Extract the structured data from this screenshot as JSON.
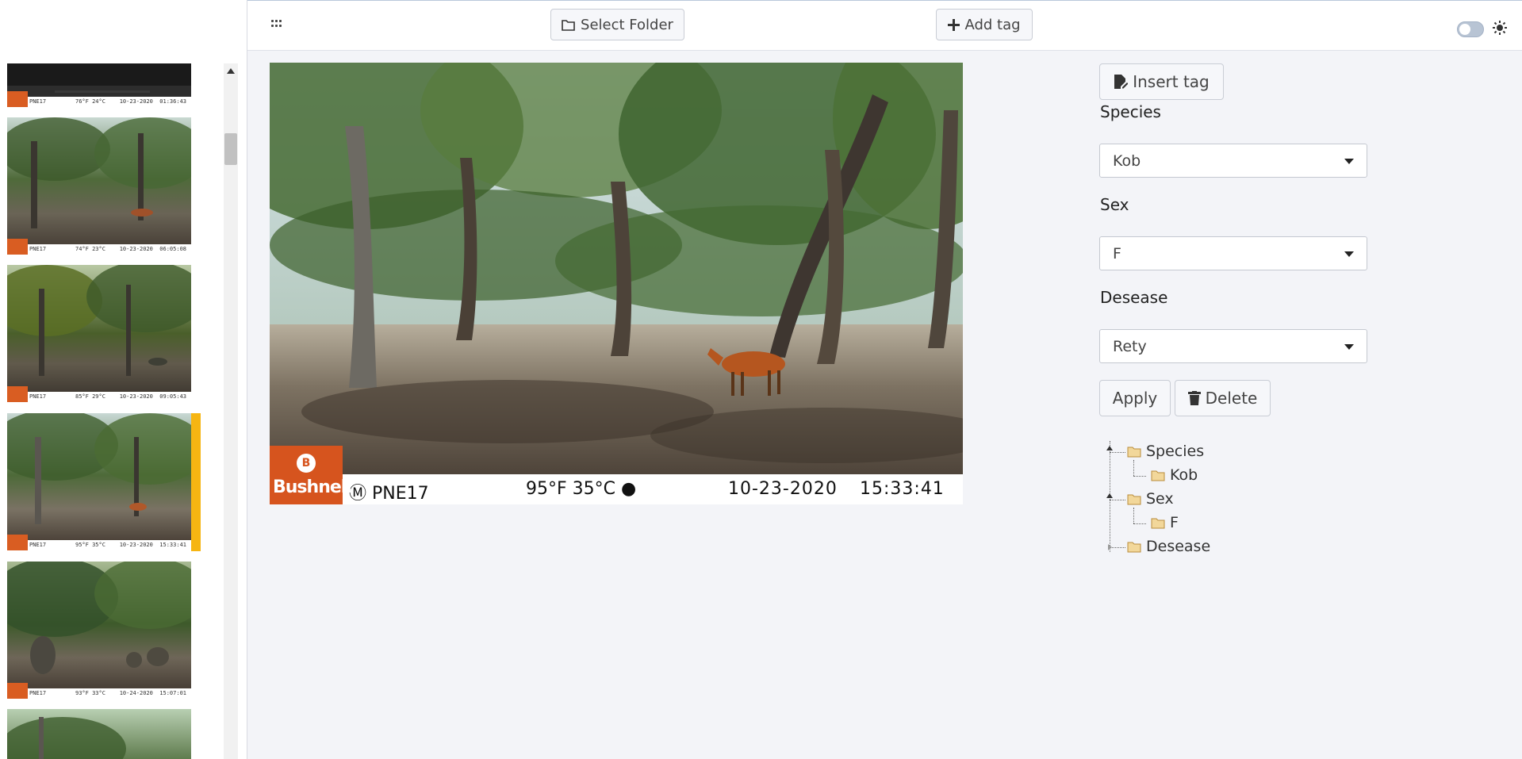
{
  "header": {
    "select_folder_label": "Select Folder",
    "add_tag_label": "Add tag",
    "menu_icon": "grid-icon",
    "theme_icon": "sun-icon",
    "theme_toggle_on": false
  },
  "sidebar": {
    "thumbnails": [
      {
        "camera": "PNE17",
        "temp": "76°F 24°C",
        "date": "10-23-2020",
        "time": "01:36:43",
        "scene": "night"
      },
      {
        "camera": "PNE17",
        "temp": "74°F 23°C",
        "date": "10-23-2020",
        "time": "06:05:08",
        "scene": "kob"
      },
      {
        "camera": "PNE17",
        "temp": "85°F 29°C",
        "date": "10-23-2020",
        "time": "09:05:43",
        "scene": "forest"
      },
      {
        "camera": "PNE17",
        "temp": "95°F 35°C",
        "date": "10-23-2020",
        "time": "15:33:41",
        "scene": "kob",
        "selected": true
      },
      {
        "camera": "PNE17",
        "temp": "93°F 33°C",
        "date": "10-24-2020",
        "time": "15:07:01",
        "scene": "baboons"
      },
      {
        "camera": "PNE17",
        "temp": "",
        "date": "",
        "time": "",
        "scene": "forest"
      }
    ]
  },
  "main_image": {
    "brand": "Bushnell",
    "camera": "PNE17",
    "temp": "95°F 35°C",
    "date": "10-23-2020",
    "time": "15:33:41"
  },
  "tag_panel": {
    "insert_tag_label": "Insert tag",
    "fields": [
      {
        "label": "Species",
        "value": "Kob"
      },
      {
        "label": "Sex",
        "value": "F"
      },
      {
        "label": "Desease",
        "value": "Rety"
      }
    ],
    "apply_label": "Apply",
    "delete_label": "Delete",
    "tree": [
      {
        "label": "Species",
        "children": [
          "Kob"
        ]
      },
      {
        "label": "Sex",
        "children": [
          "F"
        ]
      },
      {
        "label": "Desease",
        "children": []
      }
    ]
  },
  "colors": {
    "selection_bar": "#f6b512",
    "bushnell_orange": "#d6541e",
    "background": "#f3f4f8"
  }
}
